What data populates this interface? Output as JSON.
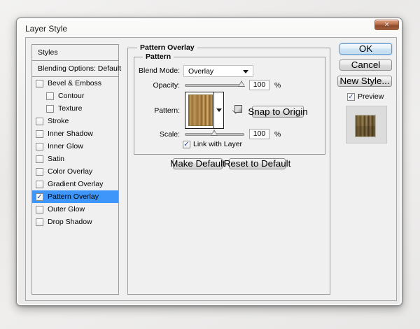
{
  "window": {
    "title": "Layer Style"
  },
  "glyphs": {
    "check": "✓",
    "close": "✕"
  },
  "colors": {
    "selection_blue": "#3e95fa",
    "wood_light": "#b0824a",
    "wood_dark": "#6d5830",
    "ok_border_blue": "#5e9ad0",
    "close_button_red": "#a25f3c"
  },
  "sidebar": {
    "styles_header": "Styles",
    "blending_header": "Blending Options: Default",
    "items": [
      {
        "label": "Bevel & Emboss",
        "checked": false,
        "indent": false,
        "selected": false
      },
      {
        "label": "Contour",
        "checked": false,
        "indent": true,
        "selected": false
      },
      {
        "label": "Texture",
        "checked": false,
        "indent": true,
        "selected": false
      },
      {
        "label": "Stroke",
        "checked": false,
        "indent": false,
        "selected": false
      },
      {
        "label": "Inner Shadow",
        "checked": false,
        "indent": false,
        "selected": false
      },
      {
        "label": "Inner Glow",
        "checked": false,
        "indent": false,
        "selected": false
      },
      {
        "label": "Satin",
        "checked": false,
        "indent": false,
        "selected": false
      },
      {
        "label": "Color Overlay",
        "checked": false,
        "indent": false,
        "selected": false
      },
      {
        "label": "Gradient Overlay",
        "checked": false,
        "indent": false,
        "selected": false
      },
      {
        "label": "Pattern Overlay",
        "checked": true,
        "indent": false,
        "selected": true
      },
      {
        "label": "Outer Glow",
        "checked": false,
        "indent": false,
        "selected": false
      },
      {
        "label": "Drop Shadow",
        "checked": false,
        "indent": false,
        "selected": false
      }
    ]
  },
  "panel": {
    "group_title": "Pattern Overlay",
    "subgroup_title": "Pattern",
    "blend_mode_label": "Blend Mode:",
    "blend_mode_value": "Overlay",
    "opacity_label": "Opacity:",
    "opacity_value": "100",
    "opacity_unit": "%",
    "opacity_slider_percent": 96,
    "pattern_label": "Pattern:",
    "pattern_swatch": "wood-texture-pattern",
    "snap_button": "Snap to Origin",
    "scale_label": "Scale:",
    "scale_value": "100",
    "scale_unit": "%",
    "scale_slider_percent": 49,
    "link_with_layer": {
      "label": "Link with Layer",
      "checked": true
    },
    "make_default": "Make Default",
    "reset_default": "Reset to Default"
  },
  "actions": {
    "ok": "OK",
    "cancel": "Cancel",
    "new_style": "New Style...",
    "preview": {
      "label": "Preview",
      "checked": true
    },
    "preview_thumbnail": "wood-texture-preview"
  }
}
